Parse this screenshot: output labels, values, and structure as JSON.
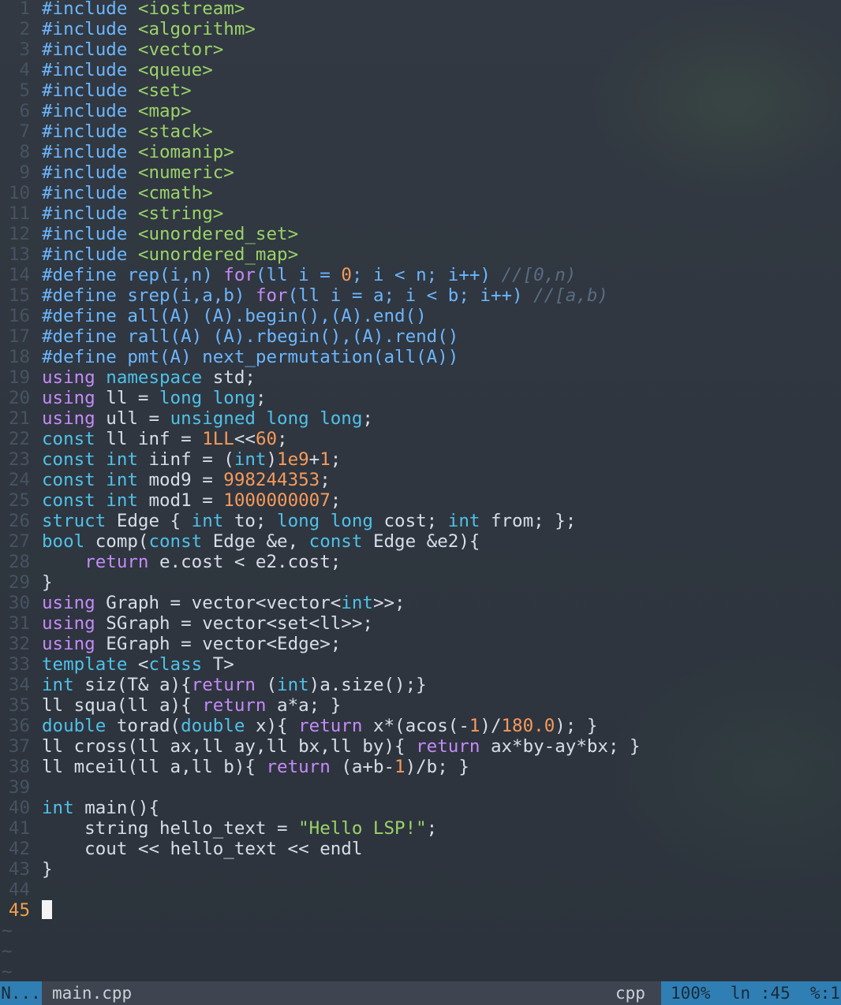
{
  "editor": {
    "current_line": "45",
    "lines": [
      {
        "n": "1",
        "tokens": [
          [
            "pre",
            "#include "
          ],
          [
            "str",
            "<iostream>"
          ]
        ]
      },
      {
        "n": "2",
        "tokens": [
          [
            "pre",
            "#include "
          ],
          [
            "str",
            "<algorithm>"
          ]
        ]
      },
      {
        "n": "3",
        "tokens": [
          [
            "pre",
            "#include "
          ],
          [
            "str",
            "<vector>"
          ]
        ]
      },
      {
        "n": "4",
        "tokens": [
          [
            "pre",
            "#include "
          ],
          [
            "str",
            "<queue>"
          ]
        ]
      },
      {
        "n": "5",
        "tokens": [
          [
            "pre",
            "#include "
          ],
          [
            "str",
            "<set>"
          ]
        ]
      },
      {
        "n": "6",
        "tokens": [
          [
            "pre",
            "#include "
          ],
          [
            "str",
            "<map>"
          ]
        ]
      },
      {
        "n": "7",
        "tokens": [
          [
            "pre",
            "#include "
          ],
          [
            "str",
            "<stack>"
          ]
        ]
      },
      {
        "n": "8",
        "tokens": [
          [
            "pre",
            "#include "
          ],
          [
            "str",
            "<iomanip>"
          ]
        ]
      },
      {
        "n": "9",
        "tokens": [
          [
            "pre",
            "#include "
          ],
          [
            "str",
            "<numeric>"
          ]
        ]
      },
      {
        "n": "10",
        "tokens": [
          [
            "pre",
            "#include "
          ],
          [
            "str",
            "<cmath>"
          ]
        ]
      },
      {
        "n": "11",
        "tokens": [
          [
            "pre",
            "#include "
          ],
          [
            "str",
            "<string>"
          ]
        ]
      },
      {
        "n": "12",
        "tokens": [
          [
            "pre",
            "#include "
          ],
          [
            "str",
            "<unordered_set>"
          ]
        ]
      },
      {
        "n": "13",
        "tokens": [
          [
            "pre",
            "#include "
          ],
          [
            "str",
            "<unordered_map>"
          ]
        ]
      },
      {
        "n": "14",
        "tokens": [
          [
            "pre",
            "#define rep(i,n) "
          ],
          [
            "kw",
            "for"
          ],
          [
            "pre",
            "(ll i = "
          ],
          [
            "num",
            "0"
          ],
          [
            "pre",
            "; i < n; i++) "
          ],
          [
            "com",
            "//[0,n)"
          ]
        ]
      },
      {
        "n": "15",
        "tokens": [
          [
            "pre",
            "#define srep(i,a,b) "
          ],
          [
            "kw",
            "for"
          ],
          [
            "pre",
            "(ll i = a; i < b; i++) "
          ],
          [
            "com",
            "//[a,b)"
          ]
        ]
      },
      {
        "n": "16",
        "tokens": [
          [
            "pre",
            "#define all(A) (A).begin(),(A).end()"
          ]
        ]
      },
      {
        "n": "17",
        "tokens": [
          [
            "pre",
            "#define rall(A) (A).rbegin(),(A).rend()"
          ]
        ]
      },
      {
        "n": "18",
        "tokens": [
          [
            "pre",
            "#define pmt(A) next_permutation(all(A))"
          ]
        ]
      },
      {
        "n": "19",
        "tokens": [
          [
            "kw",
            "using "
          ],
          [
            "ty",
            "namespace "
          ],
          [
            "id",
            "std;"
          ]
        ]
      },
      {
        "n": "20",
        "tokens": [
          [
            "kw",
            "using "
          ],
          [
            "id",
            "ll = "
          ],
          [
            "ty",
            "long long"
          ],
          [
            "id",
            ";"
          ]
        ]
      },
      {
        "n": "21",
        "tokens": [
          [
            "kw",
            "using "
          ],
          [
            "id",
            "ull = "
          ],
          [
            "ty",
            "unsigned long long"
          ],
          [
            "id",
            ";"
          ]
        ]
      },
      {
        "n": "22",
        "tokens": [
          [
            "ty",
            "const "
          ],
          [
            "id",
            "ll inf = "
          ],
          [
            "num",
            "1LL"
          ],
          [
            "id",
            "<<"
          ],
          [
            "num",
            "60"
          ],
          [
            "id",
            ";"
          ]
        ]
      },
      {
        "n": "23",
        "tokens": [
          [
            "ty",
            "const int "
          ],
          [
            "id",
            "iinf = ("
          ],
          [
            "ty",
            "int"
          ],
          [
            "id",
            ")"
          ],
          [
            "num",
            "1e9"
          ],
          [
            "id",
            "+"
          ],
          [
            "num",
            "1"
          ],
          [
            "id",
            ";"
          ]
        ]
      },
      {
        "n": "24",
        "tokens": [
          [
            "ty",
            "const int "
          ],
          [
            "id",
            "mod9 = "
          ],
          [
            "num",
            "998244353"
          ],
          [
            "id",
            ";"
          ]
        ]
      },
      {
        "n": "25",
        "tokens": [
          [
            "ty",
            "const int "
          ],
          [
            "id",
            "mod1 = "
          ],
          [
            "num",
            "1000000007"
          ],
          [
            "id",
            ";"
          ]
        ]
      },
      {
        "n": "26",
        "tokens": [
          [
            "ty",
            "struct "
          ],
          [
            "id",
            "Edge { "
          ],
          [
            "ty",
            "int "
          ],
          [
            "id",
            "to; "
          ],
          [
            "ty",
            "long long "
          ],
          [
            "id",
            "cost; "
          ],
          [
            "ty",
            "int "
          ],
          [
            "id",
            "from; };"
          ]
        ]
      },
      {
        "n": "27",
        "tokens": [
          [
            "ty",
            "bool "
          ],
          [
            "id",
            "comp("
          ],
          [
            "ty",
            "const "
          ],
          [
            "id",
            "Edge &e, "
          ],
          [
            "ty",
            "const "
          ],
          [
            "id",
            "Edge &e2){"
          ]
        ]
      },
      {
        "n": "28",
        "tokens": [
          [
            "id",
            "    "
          ],
          [
            "kw",
            "return "
          ],
          [
            "id",
            "e.cost < e2.cost;"
          ]
        ]
      },
      {
        "n": "29",
        "tokens": [
          [
            "id",
            "}"
          ]
        ]
      },
      {
        "n": "30",
        "tokens": [
          [
            "kw",
            "using "
          ],
          [
            "id",
            "Graph = vector<vector<"
          ],
          [
            "ty",
            "int"
          ],
          [
            "id",
            ">>;"
          ]
        ]
      },
      {
        "n": "31",
        "tokens": [
          [
            "kw",
            "using "
          ],
          [
            "id",
            "SGraph = vector<set<ll>>;"
          ]
        ]
      },
      {
        "n": "32",
        "tokens": [
          [
            "kw",
            "using "
          ],
          [
            "id",
            "EGraph = vector<Edge>;"
          ]
        ]
      },
      {
        "n": "33",
        "tokens": [
          [
            "ty",
            "template "
          ],
          [
            "id",
            "<"
          ],
          [
            "ty",
            "class "
          ],
          [
            "id",
            "T>"
          ]
        ]
      },
      {
        "n": "34",
        "tokens": [
          [
            "ty",
            "int "
          ],
          [
            "id",
            "siz(T& a){"
          ],
          [
            "kw",
            "return "
          ],
          [
            "id",
            "("
          ],
          [
            "ty",
            "int"
          ],
          [
            "id",
            ")a.size();}"
          ]
        ]
      },
      {
        "n": "35",
        "tokens": [
          [
            "id",
            "ll squa(ll a){ "
          ],
          [
            "kw",
            "return "
          ],
          [
            "id",
            "a*a; }"
          ]
        ]
      },
      {
        "n": "36",
        "tokens": [
          [
            "ty",
            "double "
          ],
          [
            "id",
            "torad("
          ],
          [
            "ty",
            "double "
          ],
          [
            "id",
            "x){ "
          ],
          [
            "kw",
            "return "
          ],
          [
            "id",
            "x*(acos(-"
          ],
          [
            "num",
            "1"
          ],
          [
            "id",
            ")/"
          ],
          [
            "num",
            "180.0"
          ],
          [
            "id",
            "); }"
          ]
        ]
      },
      {
        "n": "37",
        "tokens": [
          [
            "id",
            "ll cross(ll ax,ll ay,ll bx,ll by){ "
          ],
          [
            "kw",
            "return "
          ],
          [
            "id",
            "ax*by-ay*bx; }"
          ]
        ]
      },
      {
        "n": "38",
        "tokens": [
          [
            "id",
            "ll mceil(ll a,ll b){ "
          ],
          [
            "kw",
            "return "
          ],
          [
            "id",
            "(a+b-"
          ],
          [
            "num",
            "1"
          ],
          [
            "id",
            ")/b; }"
          ]
        ]
      },
      {
        "n": "39",
        "tokens": []
      },
      {
        "n": "40",
        "tokens": [
          [
            "ty",
            "int "
          ],
          [
            "id",
            "main(){"
          ]
        ]
      },
      {
        "n": "41",
        "tokens": [
          [
            "id",
            "    string hello_text = "
          ],
          [
            "str",
            "\"Hello LSP!\""
          ],
          [
            "id",
            ";"
          ]
        ]
      },
      {
        "n": "42",
        "tokens": [
          [
            "id",
            "    cout << hello_text << endl"
          ]
        ]
      },
      {
        "n": "43",
        "tokens": [
          [
            "id",
            "}"
          ]
        ]
      },
      {
        "n": "44",
        "tokens": []
      },
      {
        "n": "45",
        "tokens": []
      }
    ],
    "tilde_lines": [
      "~",
      "~",
      "~"
    ]
  },
  "statusbar": {
    "mode": "N...",
    "filename": "main.cpp",
    "filetype": "cpp",
    "position": "100%  ln :45  %:1"
  }
}
